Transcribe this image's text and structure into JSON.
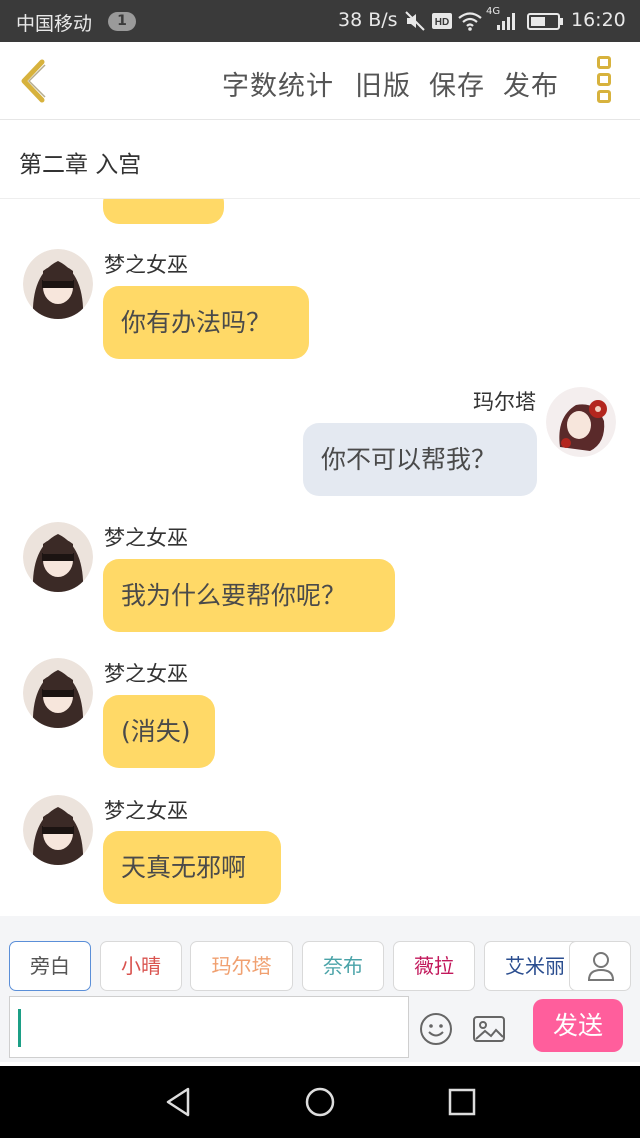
{
  "status_bar": {
    "carrier": "中国移动",
    "notification_count": "1",
    "net_speed": "38 B/s",
    "network": "4G",
    "time": "16:20"
  },
  "toolbar": {
    "word_count": "字数统计",
    "old_version": "旧版",
    "save": "保存",
    "publish": "发布"
  },
  "chapter_title": "第二章  入宫",
  "messages": [
    {
      "speaker": "梦之女巫",
      "text": "你有办法吗？",
      "side": "left"
    },
    {
      "speaker": "玛尔塔",
      "text": "你不可以帮我？",
      "side": "right"
    },
    {
      "speaker": "梦之女巫",
      "text": "我为什么要帮你呢？",
      "side": "left"
    },
    {
      "speaker": "梦之女巫",
      "text": "(消失)",
      "side": "left"
    },
    {
      "speaker": "梦之女巫",
      "text": "天真无邪啊",
      "side": "left"
    }
  ],
  "roles": [
    {
      "label": "旁白",
      "color": "#555555",
      "selected": true
    },
    {
      "label": "小晴",
      "color": "#d9534f"
    },
    {
      "label": "玛尔塔",
      "color": "#f0a070"
    },
    {
      "label": "奈布",
      "color": "#4aa3a8"
    },
    {
      "label": "薇拉",
      "color": "#c2185b"
    },
    {
      "label": "艾米丽",
      "color": "#2a4d8f"
    }
  ],
  "input": {
    "value": ""
  },
  "send_label": "发送",
  "colors": {
    "accent": "#d7b23d",
    "bubble_left": "#ffd967",
    "bubble_right": "#e4e9f1",
    "send_button": "#ff5e9c"
  }
}
